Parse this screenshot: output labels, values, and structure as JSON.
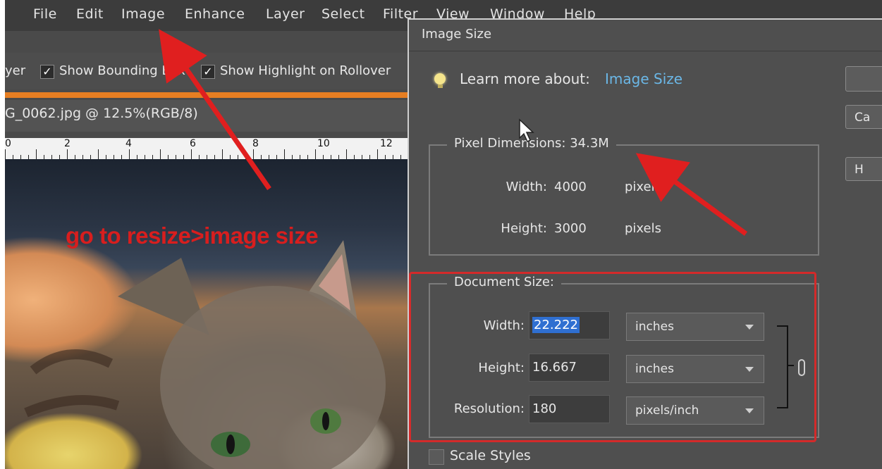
{
  "menubar": {
    "items": [
      "File",
      "Edit",
      "Image",
      "Enhance",
      "Layer",
      "Select",
      "Filter",
      "View",
      "Window",
      "Help"
    ]
  },
  "options_bar": {
    "partial_label": "yer",
    "show_bounding_box": "Show Bounding Box",
    "show_highlight": "Show Highlight on Rollover"
  },
  "document": {
    "tab_title": "G_0062.jpg @ 12.5%(RGB/8)",
    "ruler_numbers": [
      "0",
      "2",
      "4",
      "6",
      "8",
      "10",
      "12"
    ]
  },
  "annotation": {
    "text": "go to resize>image size",
    "color": "#d81e1e"
  },
  "dialog": {
    "title": "Image Size",
    "learn_more_label": "Learn more about:",
    "learn_more_link": "Image Size",
    "buttons": [
      "",
      "Ca",
      "H"
    ],
    "pixel_dimensions": {
      "legend": "Pixel Dimensions:",
      "size": "34.3M",
      "width_label": "Width:",
      "width_value": "4000",
      "width_unit": "pixels",
      "height_label": "Height:",
      "height_value": "3000",
      "height_unit": "pixels"
    },
    "document_size": {
      "legend": "Document Size:",
      "width_label": "Width:",
      "width_value": "22.222",
      "width_unit": "inches",
      "height_label": "Height:",
      "height_value": "16.667",
      "height_unit": "inches",
      "resolution_label": "Resolution:",
      "resolution_value": "180",
      "resolution_unit": "pixels/inch"
    },
    "scale_styles": "Scale Styles"
  },
  "colors": {
    "accent_link": "#6bb7e6",
    "annotation_red": "#d42a2a",
    "selection_blue": "#2f6fd1",
    "orange_bar": "#e67e22"
  }
}
